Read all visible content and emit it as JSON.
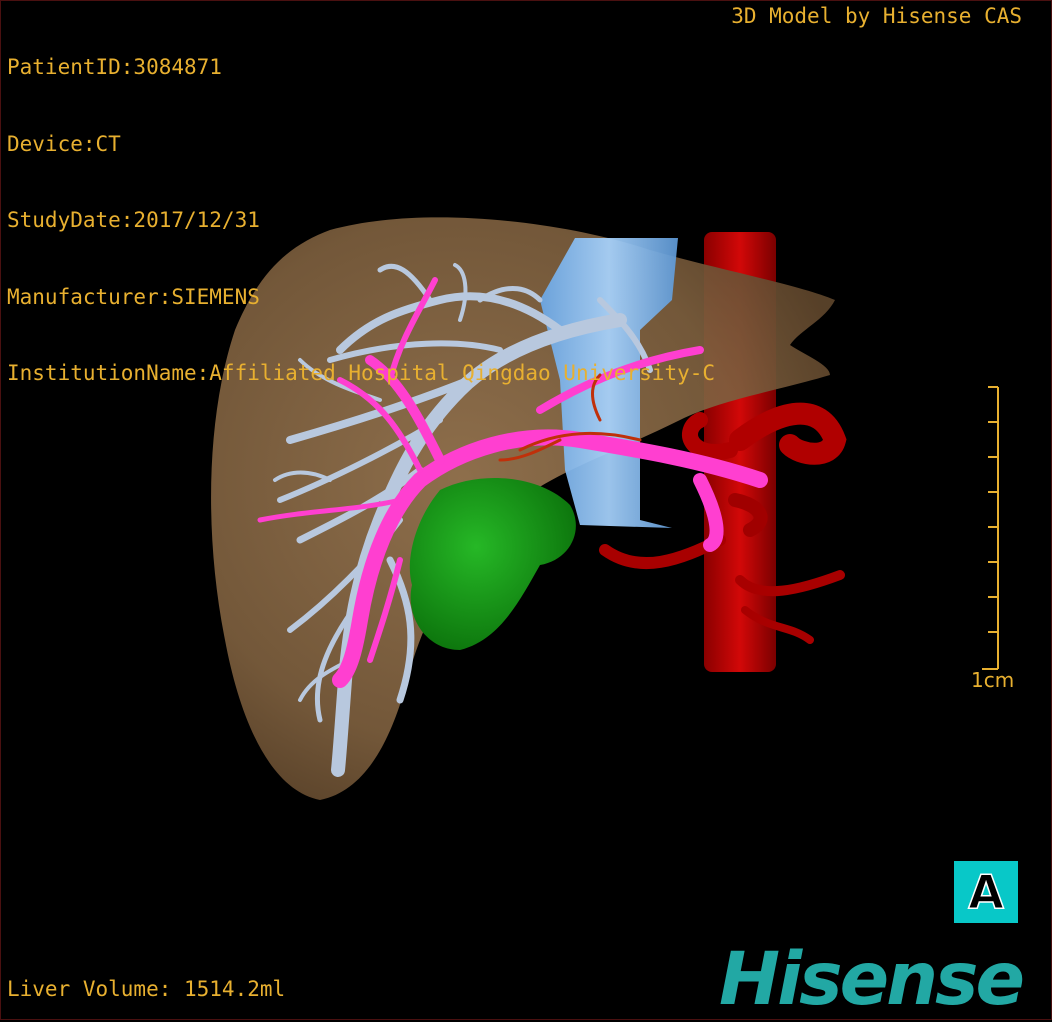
{
  "info": {
    "patient_id": "PatientID:3084871",
    "device": "Device:CT",
    "study_date": "StudyDate:2017/12/31",
    "manufacturer": "Manufacturer:SIEMENS",
    "institution": "InstitutionName:Affiliated Hospital Qingdao University-C"
  },
  "credit": "3D Model by Hisense CAS",
  "volume": "Liver Volume: 1514.2ml",
  "scale_label": "1cm",
  "orientation": "A",
  "logo": "Hisense",
  "colors": {
    "overlay_text": "#e8b030",
    "liver": "#8a6a45",
    "portal_vein": "#b8c8de",
    "hepatic_vein": "#ff3fd0",
    "ivc": "#8fc4f5",
    "aorta": "#c00000",
    "tumor": "#18a018",
    "orientation_bg": "#08c8c8",
    "logo": "#22a8a4"
  }
}
